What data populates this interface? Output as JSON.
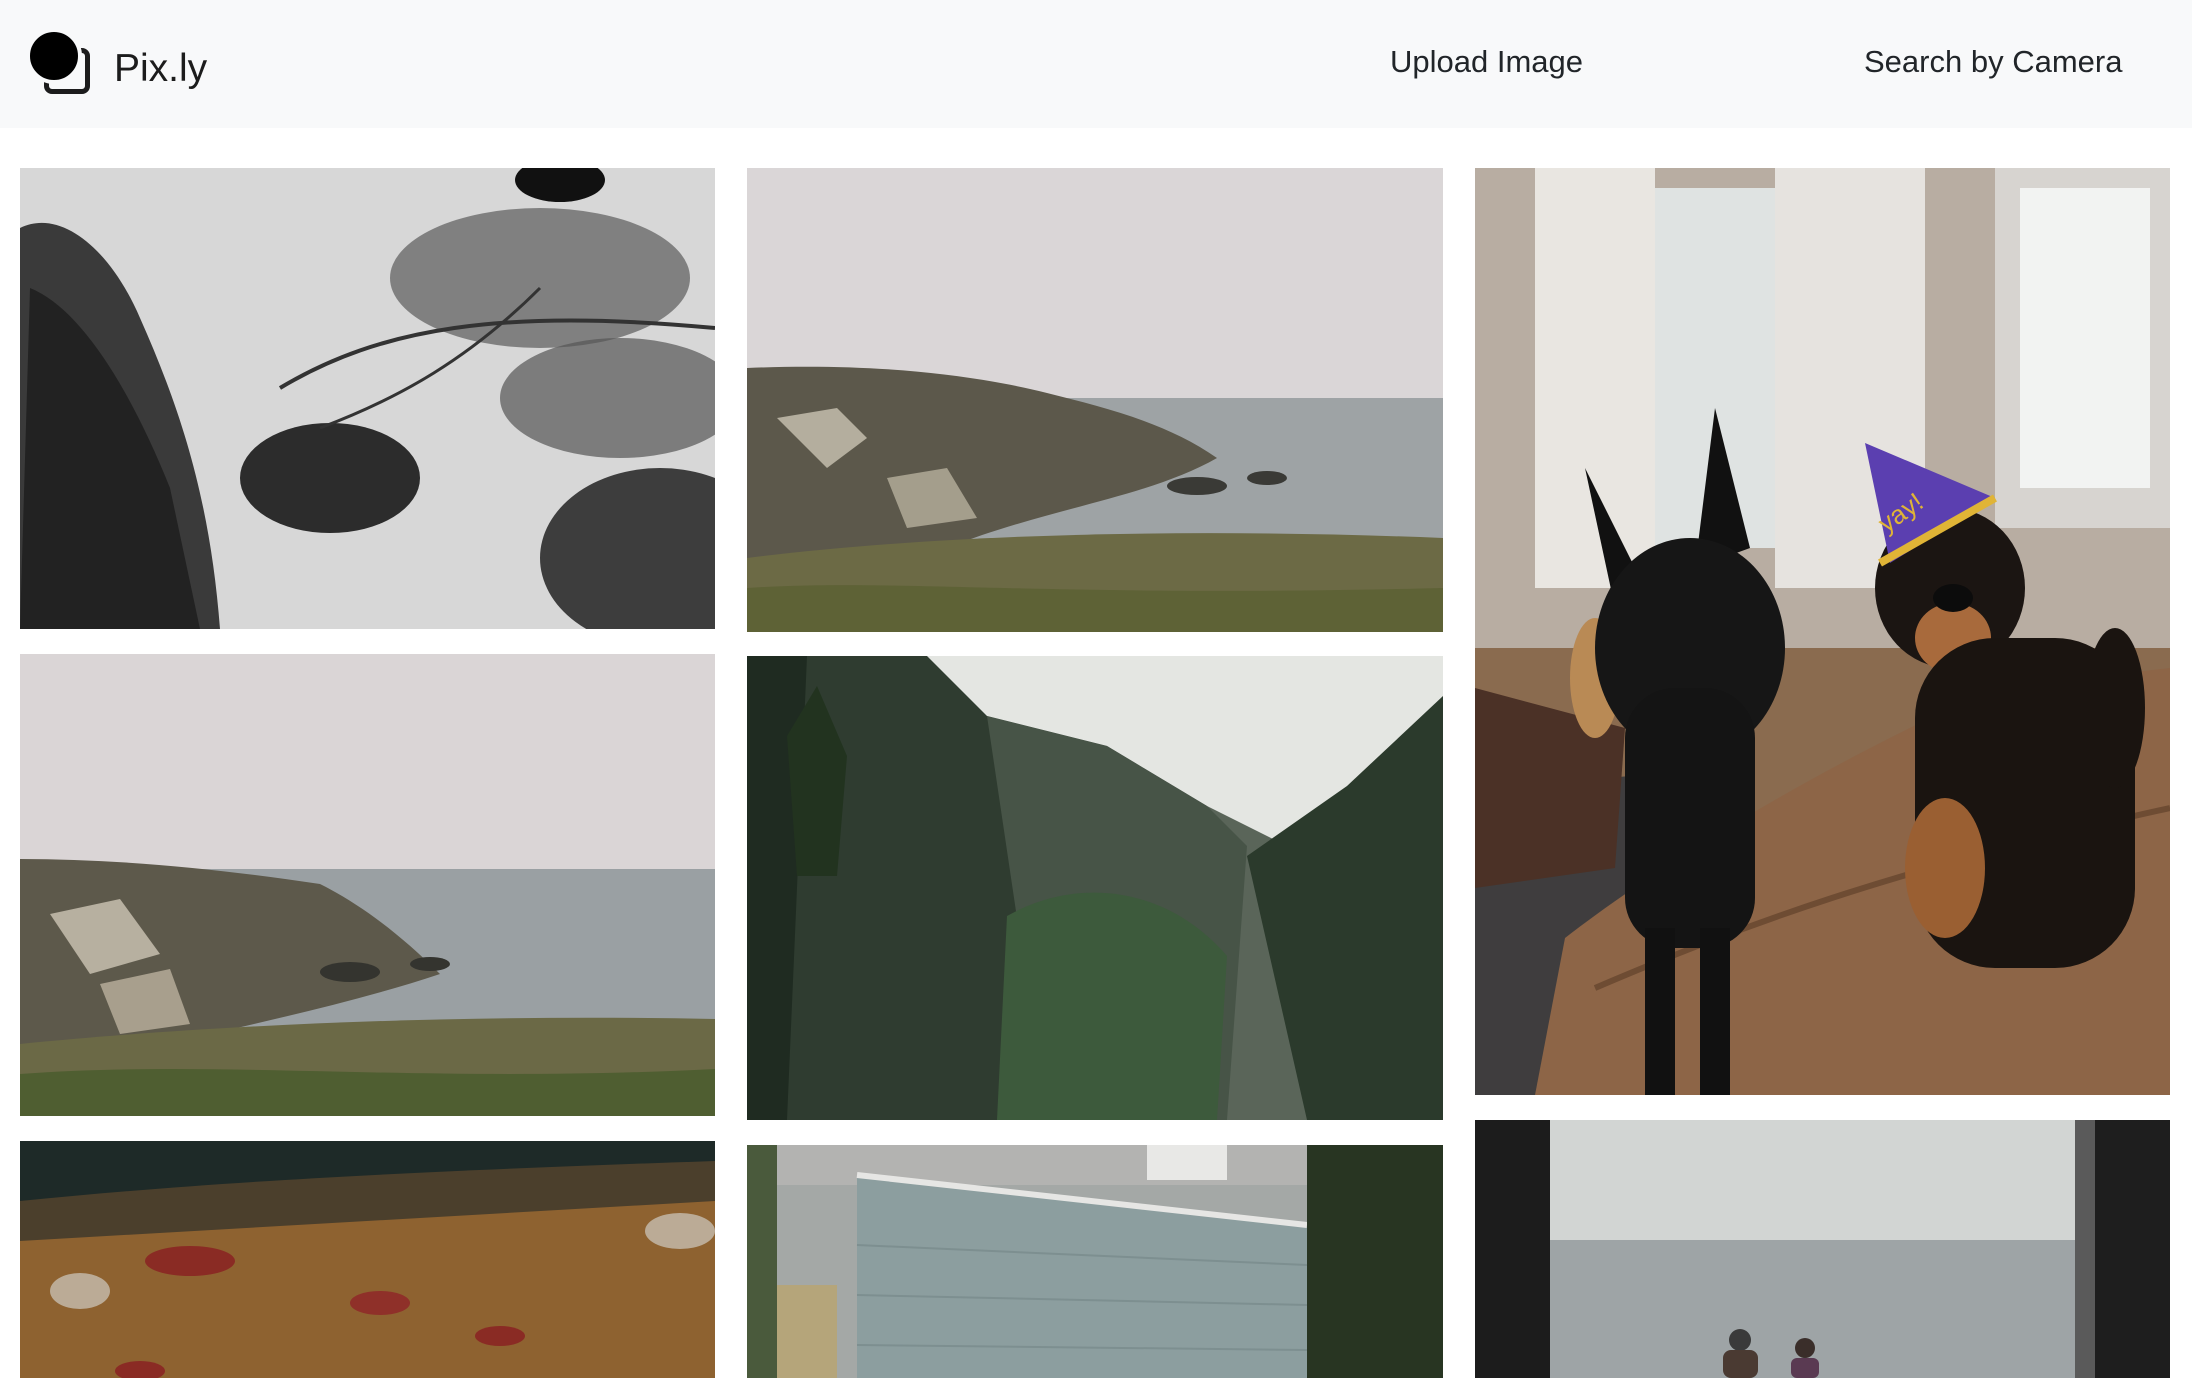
{
  "navbar": {
    "brand_name": "Pix.ly",
    "links": [
      {
        "label": "Upload Image"
      },
      {
        "label": "Search by Camera"
      }
    ]
  },
  "gallery": {
    "images": [
      {
        "subject": "black-and-white tree branches against sky"
      },
      {
        "subject": "foggy rocky coastline"
      },
      {
        "subject": "two dogs on leather couch, one wearing party hat"
      },
      {
        "subject": "foggy rocky coastline with grass"
      },
      {
        "subject": "misty evergreen forest"
      },
      {
        "subject": "blurred ceiling lights"
      },
      {
        "subject": "gray wooden house siding"
      },
      {
        "subject": "window view of foggy sea with two people"
      }
    ],
    "party_hat_text": "yay!"
  },
  "colors": {
    "navbar_bg": "#f8f9fa",
    "text": "#212529"
  }
}
